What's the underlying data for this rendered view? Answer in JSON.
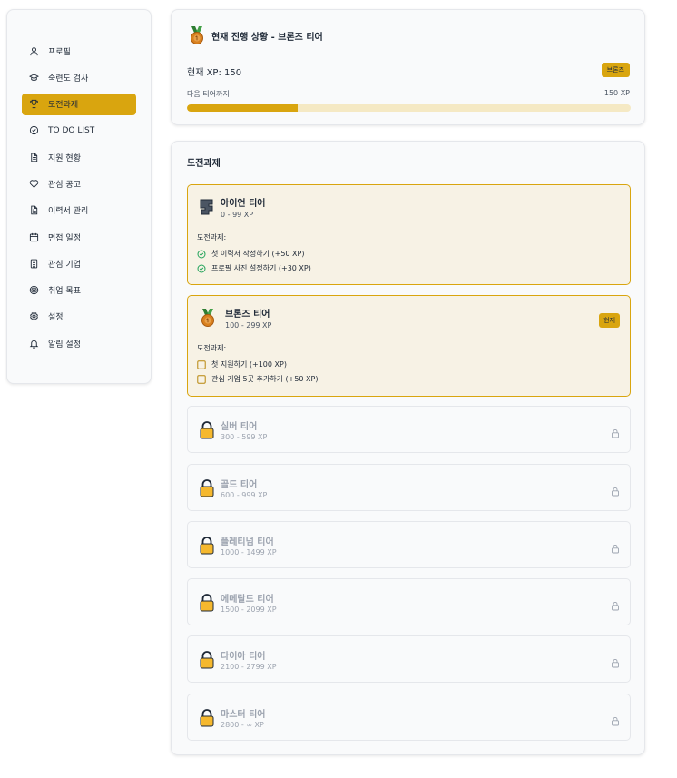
{
  "sidebar": {
    "items": [
      {
        "label": "프로필",
        "icon": "user-icon",
        "active": false
      },
      {
        "label": "숙련도 검사",
        "icon": "graduation-cap-icon",
        "active": false
      },
      {
        "label": "도전과제",
        "icon": "trophy-icon",
        "active": true
      },
      {
        "label": "TO DO LIST",
        "icon": "check-circle-icon",
        "active": false
      },
      {
        "label": "지원 현황",
        "icon": "document-icon",
        "active": false
      },
      {
        "label": "관심 공고",
        "icon": "heart-icon",
        "active": false
      },
      {
        "label": "이력서 관리",
        "icon": "file-text-icon",
        "active": false
      },
      {
        "label": "면접 일정",
        "icon": "calendar-icon",
        "active": false
      },
      {
        "label": "관심 기업",
        "icon": "building-icon",
        "active": false
      },
      {
        "label": "취업 목표",
        "icon": "target-icon",
        "active": false
      },
      {
        "label": "설정",
        "icon": "gear-icon",
        "active": false
      },
      {
        "label": "알림 설정",
        "icon": "bell-icon",
        "active": false
      }
    ]
  },
  "status": {
    "title": "현재 진행 상황 - 브론즈 티어",
    "xp_label": "현재 XP: 150",
    "tier_badge": "브론즈",
    "next_label": "다음 티어까지",
    "next_value": "150 XP",
    "progress": 0.25
  },
  "challenges": {
    "section_title": "도전과제",
    "challenge_heading": "도전과제:",
    "current_badge": "현재",
    "tiers": [
      {
        "name": "아이언 티어",
        "range": "0 - 99 XP",
        "icon": "iron-ingot-icon",
        "state": "completed",
        "items": [
          {
            "label": "첫 이력서 작성하기 (+50 XP)",
            "done": true
          },
          {
            "label": "프로필 사진 설정하기 (+30 XP)",
            "done": true
          }
        ]
      },
      {
        "name": "브론즈 티어",
        "range": "100 - 299 XP",
        "icon": "bronze-medal-icon",
        "state": "current",
        "items": [
          {
            "label": "첫 지원하기 (+100 XP)",
            "done": false
          },
          {
            "label": "관심 기업 5곳 추가하기 (+50 XP)",
            "done": false
          }
        ]
      },
      {
        "name": "실버 티어",
        "range": "300 - 599 XP",
        "icon": "lock-icon",
        "state": "locked"
      },
      {
        "name": "골드 티어",
        "range": "600 - 999 XP",
        "icon": "lock-icon",
        "state": "locked"
      },
      {
        "name": "플레티넘 티어",
        "range": "1000 - 1499 XP",
        "icon": "lock-icon",
        "state": "locked"
      },
      {
        "name": "에메랄드 티어",
        "range": "1500 - 2099 XP",
        "icon": "lock-icon",
        "state": "locked"
      },
      {
        "name": "다이아 티어",
        "range": "2100 - 2799 XP",
        "icon": "lock-icon",
        "state": "locked"
      },
      {
        "name": "마스터 티어",
        "range": "2800 - ∞ XP",
        "icon": "lock-icon",
        "state": "locked"
      }
    ]
  },
  "colors": {
    "accent": "#d9a50f",
    "unlocked_bg": "#f7f2e5",
    "check_green": "#22a35a"
  }
}
